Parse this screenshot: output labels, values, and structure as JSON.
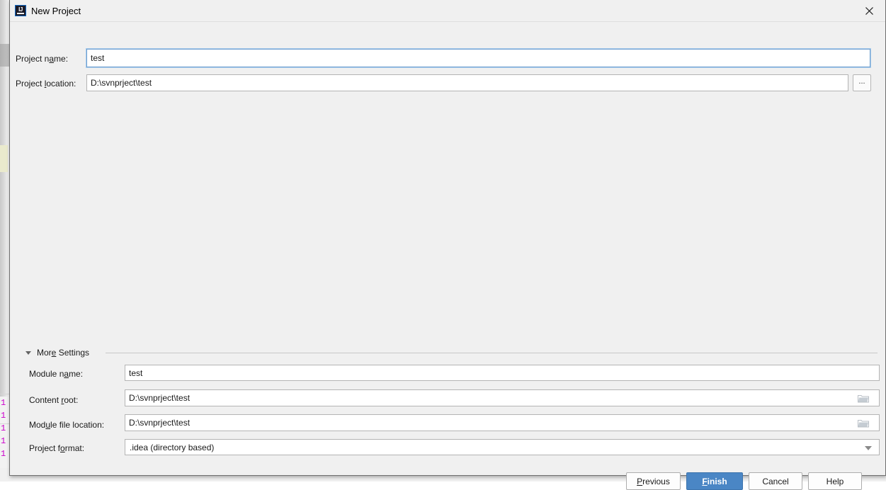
{
  "window": {
    "title": "New Project",
    "app_icon": "intellij-idea-icon",
    "close_icon": "close-icon"
  },
  "fields": {
    "project_name": {
      "label_pre": "Project n",
      "label_mn": "a",
      "label_post": "me:",
      "value": "test",
      "focused": true
    },
    "project_location": {
      "label_pre": "Project ",
      "label_mn": "l",
      "label_post": "ocation:",
      "value": "D:\\svnprject\\test",
      "browse_label": "..."
    }
  },
  "more_settings": {
    "label_pre": "Mor",
    "label_mn": "e",
    "label_post": " Settings",
    "expanded": true,
    "fields": {
      "module_name": {
        "label_pre": "Module n",
        "label_mn": "a",
        "label_post": "me:",
        "value": "test"
      },
      "content_root": {
        "label_pre": "Content ",
        "label_mn": "r",
        "label_post": "oot:",
        "value": "D:\\svnprject\\test",
        "browse_icon": "folder-icon"
      },
      "module_file_location": {
        "label_pre": "Mod",
        "label_mn": "u",
        "label_post": "le file location:",
        "value": "D:\\svnprject\\test",
        "browse_icon": "folder-icon"
      },
      "project_format": {
        "label_pre": "Project f",
        "label_mn": "o",
        "label_post": "rmat:",
        "value": ".idea (directory based)",
        "dropdown_icon": "chevron-down-icon"
      }
    }
  },
  "buttons": {
    "previous": {
      "pre": "",
      "mn": "P",
      "post": "revious"
    },
    "finish": {
      "pre": "",
      "mn": "F",
      "post": "inish",
      "primary": true
    },
    "cancel": {
      "pre": "Cancel",
      "mn": "",
      "post": ""
    },
    "help": {
      "pre": "Help",
      "mn": "",
      "post": ""
    }
  },
  "colors": {
    "dialog_bg": "#f0f0f0",
    "primary_button": "#4a86c5",
    "focus_border": "#6f9fd0",
    "line_number": "#cc00cc"
  },
  "background": {
    "line_numbers": [
      "1",
      "1",
      "1",
      "1",
      "1"
    ]
  }
}
